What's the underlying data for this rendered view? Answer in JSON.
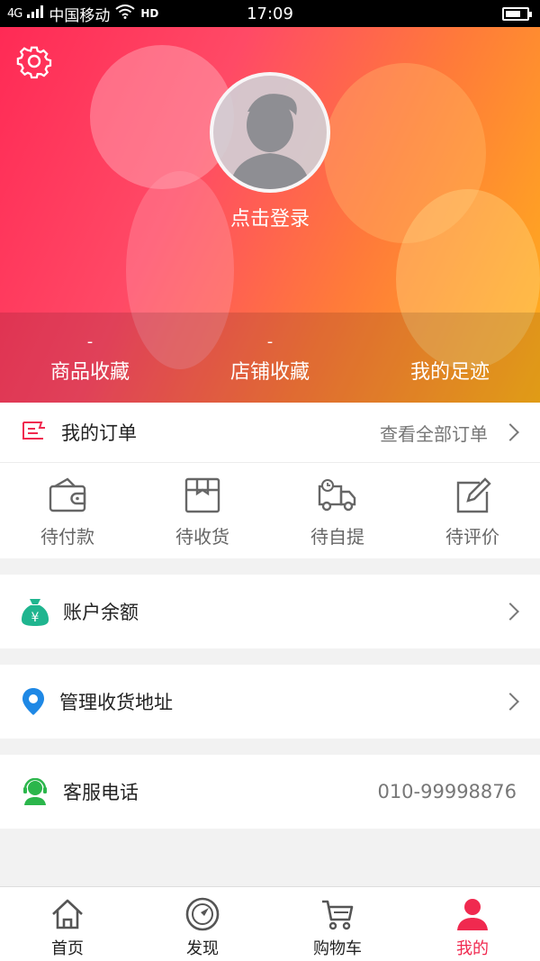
{
  "status_bar": {
    "network": "4G",
    "carrier": "中国移动",
    "hd": "HD",
    "time": "17:09"
  },
  "hero": {
    "login_text": "点击登录",
    "stats": [
      {
        "count": "-",
        "label": "商品收藏"
      },
      {
        "count": "-",
        "label": "店铺收藏"
      },
      {
        "count": "",
        "label": "我的足迹"
      }
    ]
  },
  "orders": {
    "title": "我的订单",
    "view_all": "查看全部订单",
    "items": [
      {
        "label": "待付款",
        "icon": "wallet-icon"
      },
      {
        "label": "待收货",
        "icon": "package-icon"
      },
      {
        "label": "待自提",
        "icon": "truck-icon"
      },
      {
        "label": "待评价",
        "icon": "edit-icon"
      }
    ]
  },
  "balance": {
    "title": "账户余额",
    "icon": "money-bag-icon"
  },
  "address": {
    "title": "管理收货地址",
    "icon": "location-pin-icon"
  },
  "service": {
    "title": "客服电话",
    "phone": "010-99998876",
    "icon": "customer-service-icon"
  },
  "tabbar": {
    "tabs": [
      {
        "label": "首页",
        "icon": "home-icon"
      },
      {
        "label": "发现",
        "icon": "compass-icon"
      },
      {
        "label": "购物车",
        "icon": "cart-icon"
      },
      {
        "label": "我的",
        "icon": "user-icon",
        "active": true
      }
    ]
  },
  "colors": {
    "accent": "#f0294f",
    "balance_icon": "#1fb58f",
    "address_icon": "#1e88e5",
    "service_icon": "#2bb64b"
  }
}
